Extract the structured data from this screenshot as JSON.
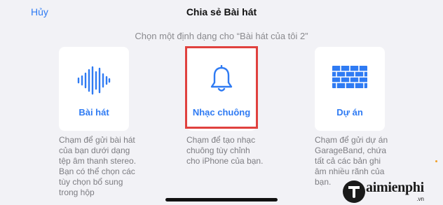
{
  "header": {
    "cancel_label": "Hủy",
    "title": "Chia sẻ Bài hát"
  },
  "subtitle": "Chọn một định dạng cho “Bài hát của tôi 2”",
  "options": [
    {
      "label": "Bài hát",
      "icon": "waveform-icon",
      "description": "Chạm để gửi bài hát của bạn dưới dạng tệp âm thanh stereo. Bạn có thể chọn các tùy chọn bổ sung trong hộp"
    },
    {
      "label": "Nhạc chuông",
      "icon": "bell-icon",
      "description": "Chạm để tạo nhạc chuông tùy chỉnh cho iPhone của bạn.",
      "highlighted": true
    },
    {
      "label": "Dự án",
      "icon": "bricks-icon",
      "description": "Chạm để gửi dự án GarageBand, chứa tất cả các bản ghi âm nhiều rãnh của bạn."
    }
  ],
  "watermark": {
    "text": "aimienphi",
    "suffix": ".vn"
  },
  "colors": {
    "accent": "#2f7bf3",
    "highlight": "#e0413e",
    "background": "#f2f2f6"
  }
}
